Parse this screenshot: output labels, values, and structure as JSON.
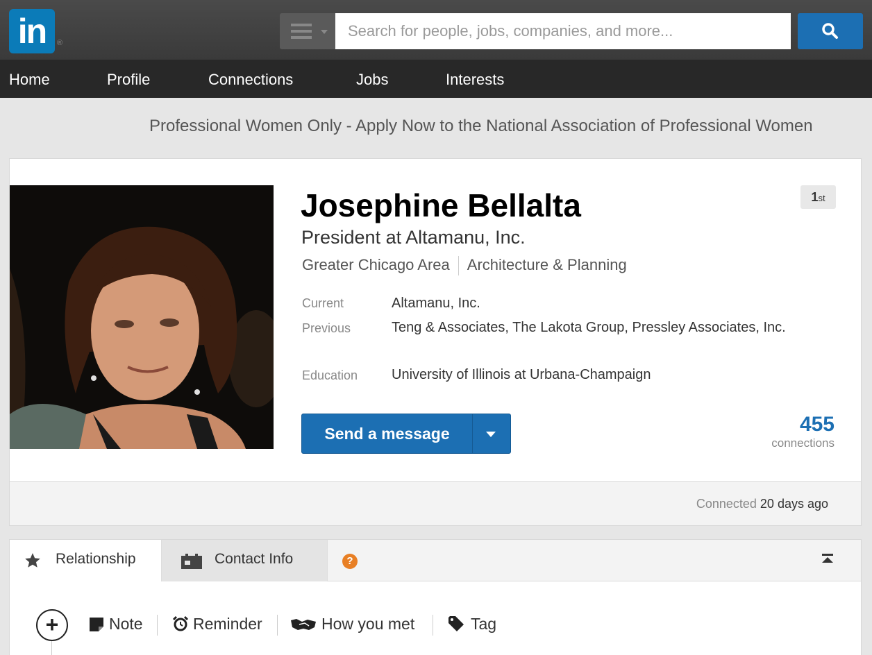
{
  "topbar": {
    "logo_text": "in",
    "logo_reg": "®",
    "search_placeholder": "Search for people, jobs, companies, and more..."
  },
  "nav": {
    "items": [
      {
        "label": "Home"
      },
      {
        "label": "Profile"
      },
      {
        "label": "Connections"
      },
      {
        "label": "Jobs"
      },
      {
        "label": "Interests"
      }
    ]
  },
  "ad": {
    "text": "Professional Women Only - Apply Now to the National Association of Professional Women"
  },
  "profile": {
    "name": "Josephine Bellalta",
    "degree_num": "1",
    "degree_suffix": "st",
    "headline": "President at Altamanu, Inc.",
    "location": "Greater Chicago Area",
    "industry": "Architecture & Planning",
    "current_label": "Current",
    "current_value": "Altamanu, Inc.",
    "previous_label": "Previous",
    "previous_value": "Teng & Associates, The Lakota Group, Pressley Associates, Inc.",
    "education_label": "Education",
    "education_value": "University of Illinois at Urbana-Champaign",
    "send_message_label": "Send a message",
    "connections_count": "455",
    "connections_label": "connections",
    "connected_prefix": "Connected",
    "connected_time": "20 days ago"
  },
  "relationship": {
    "tabs": [
      {
        "label": "Relationship",
        "icon": "star-icon"
      },
      {
        "label": "Contact Info",
        "icon": "contact-card-icon"
      }
    ],
    "help_glyph": "?",
    "add_glyph": "+",
    "actions": [
      {
        "label": "Note",
        "icon": "note-icon"
      },
      {
        "label": "Reminder",
        "icon": "alarm-clock-icon"
      },
      {
        "label": "How you met",
        "icon": "handshake-icon"
      },
      {
        "label": "Tag",
        "icon": "tag-icon"
      }
    ]
  },
  "colors": {
    "brand_blue": "#0b7bb8",
    "button_blue": "#1c6fb3",
    "help_orange": "#e87f24"
  }
}
